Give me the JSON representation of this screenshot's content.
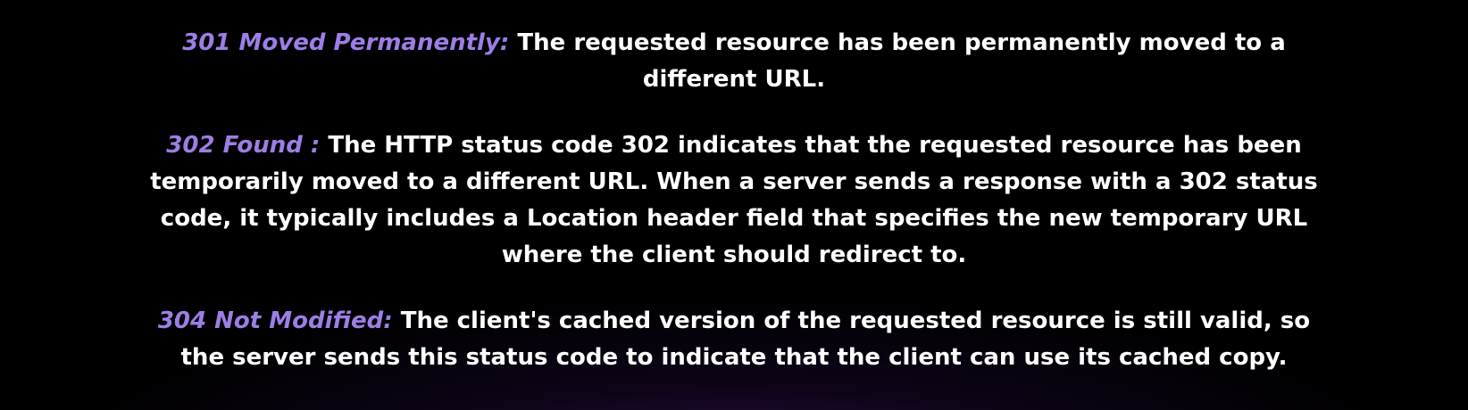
{
  "colors": {
    "background": "#000000",
    "term": "#9d7ee6",
    "text": "#ffffff",
    "glow": "#4a1a7a"
  },
  "entries": [
    {
      "term": "301 Moved Permanently:",
      "description": "The requested resource has been permanently moved to a different URL."
    },
    {
      "term": "302 Found :",
      "description": "The HTTP status code 302 indicates that the requested resource has been temporarily moved to a different URL. When a server sends a response with a 302 status code, it typically includes a Location header field that specifies the new temporary URL where the client should redirect to."
    },
    {
      "term": "304 Not Modified:",
      "description": "The client's cached version of the requested resource is still valid, so the server sends this status code to indicate that the client can use its cached copy."
    }
  ]
}
